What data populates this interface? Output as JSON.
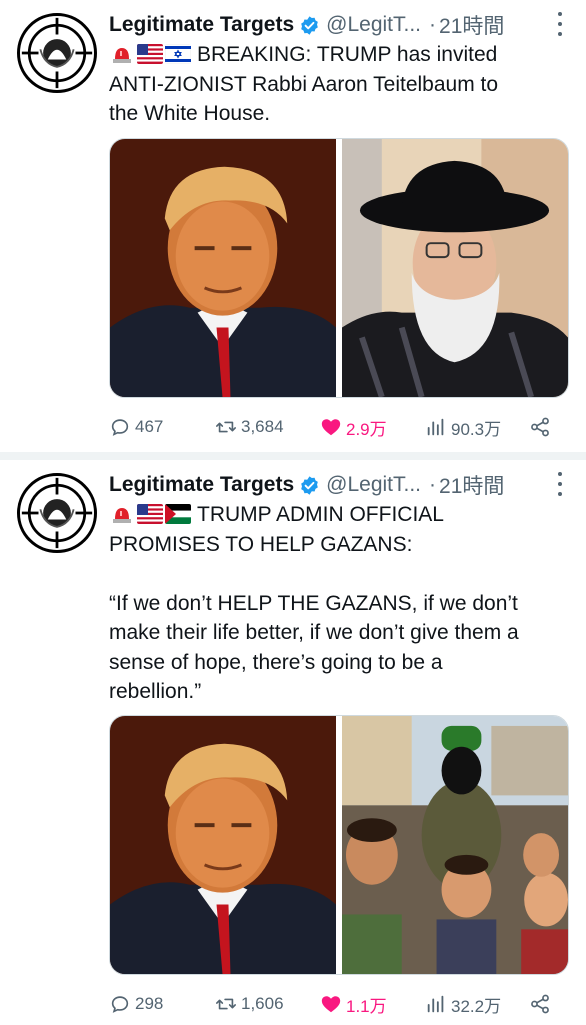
{
  "tweets": [
    {
      "author": {
        "name": "Legitimate Targets",
        "handle": "@LegitT...",
        "verified": true
      },
      "time": "21時間",
      "lines": [
        "BREAKING: TRUMP has invited",
        "ANTI-ZIONIST Rabbi Aaron Teitelbaum to",
        "the White House."
      ],
      "flags": [
        "siren-icon",
        "us-flag-icon",
        "israel-flag-icon"
      ],
      "media": [
        "trump-portrait",
        "rabbi-photo"
      ],
      "stats": {
        "replies": "467",
        "reposts": "3,684",
        "likes": "2.9万",
        "views": "90.3万"
      }
    },
    {
      "author": {
        "name": "Legitimate Targets",
        "handle": "@LegitT...",
        "verified": true
      },
      "time": "21時間",
      "lines": [
        "TRUMP ADMIN OFFICIAL",
        "PROMISES TO HELP GAZANS:",
        "",
        "“If we don’t HELP THE GAZANS, if we don’t",
        "make their life better, if we don’t give them a",
        "sense of hope, there’s going to be a",
        "rebellion.”"
      ],
      "flags": [
        "siren-icon",
        "us-flag-icon",
        "palestine-flag-icon"
      ],
      "media": [
        "trump-portrait",
        "gaza-crowd-photo"
      ],
      "stats": {
        "replies": "298",
        "reposts": "1,606",
        "likes": "1.1万",
        "views": "32.2万"
      }
    }
  ],
  "colors": {
    "text": "#0f1419",
    "muted": "#536471",
    "like": "#f91880",
    "verified": "#1d9bf0",
    "divider": "#eff3f4"
  }
}
